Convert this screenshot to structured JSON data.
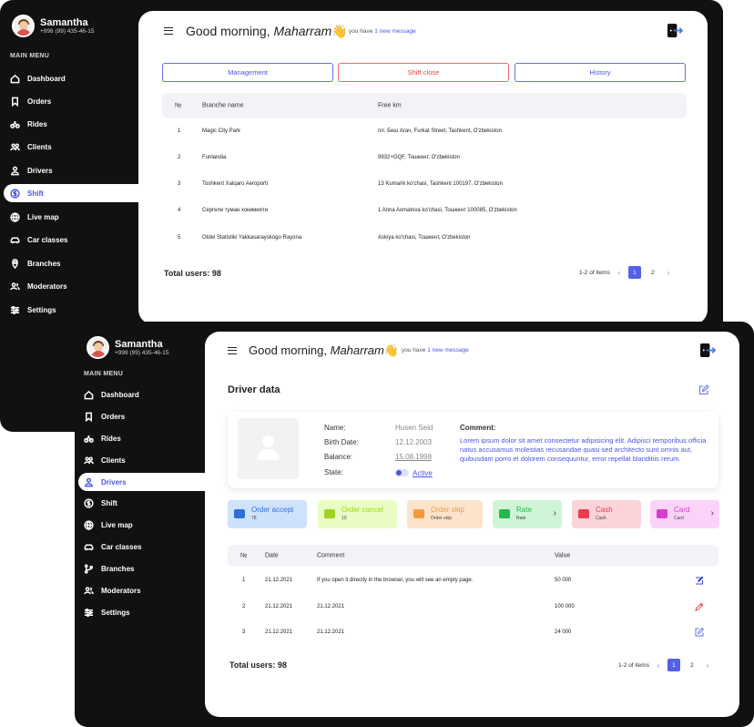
{
  "profile": {
    "name": "Samantha",
    "phone": "+998 (99) 435-46-15"
  },
  "menu_label": "MAIN MENU",
  "menu": [
    {
      "label": "Dashboard",
      "icon": "home-icon"
    },
    {
      "label": "Orders",
      "icon": "bookmark-icon"
    },
    {
      "label": "Rides",
      "icon": "bike-icon"
    },
    {
      "label": "Clients",
      "icon": "users-icon"
    },
    {
      "label": "Drivers",
      "icon": "driver-icon"
    },
    {
      "label": "Shift",
      "icon": "dollar-icon"
    },
    {
      "label": "Live map",
      "icon": "globe-icon"
    },
    {
      "label": "Car classes",
      "icon": "car-icon"
    },
    {
      "label": "Branches",
      "icon": "pin-icon"
    },
    {
      "label": "Moderators",
      "icon": "moderators-icon"
    },
    {
      "label": "Settings",
      "icon": "sliders-icon"
    }
  ],
  "menu2": [
    {
      "label": "Dashboard"
    },
    {
      "label": "Orders"
    },
    {
      "label": "Rides"
    },
    {
      "label": "Clients"
    },
    {
      "label": "Drivers"
    },
    {
      "label": "Shift"
    },
    {
      "label": "Live map"
    },
    {
      "label": "Car classes"
    },
    {
      "label": "Branches"
    },
    {
      "label": "Moderators"
    },
    {
      "label": "Settings"
    }
  ],
  "header": {
    "greeting": "Good morning, ",
    "user": "Maharram",
    "emoji": "👋",
    "msg_prefix": "you have ",
    "msg_link": "1 new message"
  },
  "shift_page": {
    "tabs": [
      "Management",
      "Shift close",
      "History"
    ],
    "columns": [
      "№",
      "Branche name",
      "Free km"
    ],
    "rows": [
      [
        "1",
        "Magic City Park",
        "пл. Бeш Агач, Furkat Street, Tashkent, O'zbekiston"
      ],
      [
        "2",
        "Funlandia",
        "9932+GQF, Тошкент, O'zbekiston"
      ],
      [
        "3",
        "Toshkent Xalqaro Aeroporti",
        "13 Kumarik ko'chasi, Tashkent 100197, O'zbekiston"
      ],
      [
        "4",
        "Сергели туман хокимияти",
        "1 Anna Axmatova ko'chasi, Тошкент 100085, O'zbekiston"
      ],
      [
        "5",
        "Otdel Statistiki Yakkasarayskogo Rayona",
        "Askiya ko'chasi, Тошкент, O'zbekiston"
      ]
    ],
    "total": "Total users: 98",
    "range": "1-2 of items",
    "pages": [
      "1",
      "2"
    ]
  },
  "driver_page": {
    "title": "Driver data",
    "fields": [
      {
        "label": "Name:",
        "value": "Husen Seid"
      },
      {
        "label": "Birth Date:",
        "value": "12.12.2003"
      },
      {
        "label": "Balance:",
        "value": "15.08.1998"
      },
      {
        "label": "State:",
        "value": "Active"
      }
    ],
    "comment_title": "Comment:",
    "comment": "Lorem ipsum dolor sit amet consectetur adipisicing elit. Adipisci temporibus officia natus accusamus molestias recusandae quasi sed architecto sunt omnis aut, quibusdam porro et dolorem consequuntur, error repellat blanditiis rerum.",
    "stats": [
      {
        "label": "Order accept",
        "sub": "78",
        "bg": "#cfe2fb",
        "fg": "#2f6fd8"
      },
      {
        "label": "Order cancel",
        "sub": "10",
        "bg": "#eafcc4",
        "fg": "#9ed321"
      },
      {
        "label": "Order skip",
        "sub": "Order skip",
        "bg": "#fde3cc",
        "fg": "#f59a3c"
      },
      {
        "label": "Rate",
        "sub": "Rate",
        "bg": "#cff5d6",
        "fg": "#25b84a"
      },
      {
        "label": "Cash",
        "sub": "Cash",
        "bg": "#fbd3d8",
        "fg": "#e6404f"
      },
      {
        "label": "Card",
        "sub": "Card",
        "bg": "#fbd3f8",
        "fg": "#d83fcf"
      }
    ],
    "columns": [
      "№",
      "Date",
      "Comment",
      "Value"
    ],
    "rows": [
      [
        "1",
        "21.12.2021",
        "If you open it directly in the browser, you will see an empty page.",
        "50 000"
      ],
      [
        "2",
        "21.12.2021",
        "21.12.2021",
        "100 000"
      ],
      [
        "3",
        "21.12.2021",
        "21.12.2021",
        "24 000"
      ]
    ],
    "total": "Total users: 98",
    "range": "1-2 of items",
    "pages": [
      "1",
      "2"
    ]
  },
  "colors": {
    "accent": "#4a56e2",
    "dark": "#111111",
    "danger": "#e04848"
  }
}
